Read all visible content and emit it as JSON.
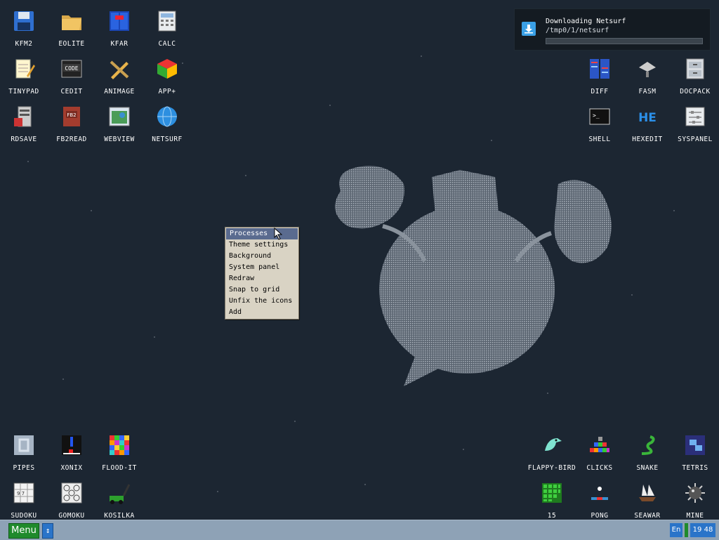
{
  "desktop": {
    "icons_left_top": [
      {
        "label": "KFM2",
        "icon": "floppy-icon"
      },
      {
        "label": "EOLITE",
        "icon": "folder-icon"
      },
      {
        "label": "KFAR",
        "icon": "file-manager-icon"
      },
      {
        "label": "CALC",
        "icon": "calculator-icon"
      },
      {
        "label": "TINYPAD",
        "icon": "notepad-icon"
      },
      {
        "label": "CEDIT",
        "icon": "code-icon"
      },
      {
        "label": "ANIMAGE",
        "icon": "paint-tools-icon"
      },
      {
        "label": "APP+",
        "icon": "cube-icon"
      },
      {
        "label": "RDSAVE",
        "icon": "ramdisk-save-icon"
      },
      {
        "label": "FB2READ",
        "icon": "book-icon"
      },
      {
        "label": "WEBVIEW",
        "icon": "webview-icon"
      },
      {
        "label": "NETSURF",
        "icon": "globe-icon"
      }
    ],
    "icons_right_top": [
      {
        "label": "DIFF",
        "icon": "diff-icon"
      },
      {
        "label": "FASM",
        "icon": "assembler-icon"
      },
      {
        "label": "DOCPACK",
        "icon": "cabinet-icon"
      },
      {
        "label": "SHELL",
        "icon": "terminal-icon"
      },
      {
        "label": "HEXEDIT",
        "icon": "hex-icon"
      },
      {
        "label": "SYSPANEL",
        "icon": "sliders-icon"
      }
    ],
    "icons_left_bottom": [
      {
        "label": "PIPES",
        "icon": "pipes-icon"
      },
      {
        "label": "XONIX",
        "icon": "xonix-icon"
      },
      {
        "label": "FLOOD-IT",
        "icon": "flood-grid-icon"
      },
      {
        "label": "SUDOKU",
        "icon": "sudoku-icon"
      },
      {
        "label": "GOMOKU",
        "icon": "gomoku-icon"
      },
      {
        "label": "KOSILKA",
        "icon": "lawnmower-icon"
      }
    ],
    "icons_right_bottom": [
      {
        "label": "FLAPPY-BIRD",
        "icon": "bird-icon"
      },
      {
        "label": "CLICKS",
        "icon": "blocks-icon"
      },
      {
        "label": "SNAKE",
        "icon": "snake-icon"
      },
      {
        "label": "TETRIS",
        "icon": "tetris-icon"
      },
      {
        "label": "15",
        "icon": "fifteen-grid-icon"
      },
      {
        "label": "PONG",
        "icon": "pong-icon"
      },
      {
        "label": "SEAWAR",
        "icon": "ship-icon"
      },
      {
        "label": "MINE",
        "icon": "mine-icon"
      }
    ]
  },
  "context_menu": {
    "items": [
      "Processes",
      "Theme settings",
      "Background",
      "System panel",
      "Redraw",
      "Snap to grid",
      "Unfix the icons",
      "Add"
    ],
    "selected_index": 0
  },
  "notification": {
    "title": "Downloading Netsurf",
    "path": "/tmp0/1/netsurf",
    "progress": 0.0
  },
  "taskbar": {
    "menu_label": "Menu",
    "scroll_glyph": "↕",
    "language": "En",
    "time": "19 48"
  },
  "colors": {
    "desktop_bg": "#1c2632",
    "taskbar_bg": "#8ea2b6",
    "menu_green": "#1f8a2c",
    "accent_blue": "#2a74c9",
    "menu_selected": "#5a6b8f"
  }
}
